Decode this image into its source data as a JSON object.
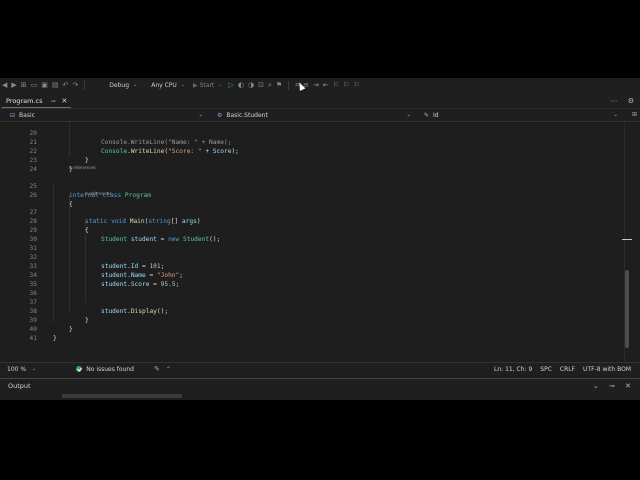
{
  "toolbar": {
    "config": "Debug",
    "platform": "Any CPU",
    "start_label": "Start"
  },
  "tab": {
    "label": "Program.cs"
  },
  "navbar": {
    "project": "Basic",
    "type": "Basic.Student",
    "member": "Id"
  },
  "editor": {
    "codelens_text": "0 references",
    "lines": [
      "20",
      "21",
      "22",
      "23",
      "24",
      "25",
      "26",
      "27",
      "28",
      "29",
      "30",
      "31",
      "32",
      "33",
      "34",
      "35",
      "36",
      "37",
      "38",
      "39",
      "40",
      "41"
    ]
  },
  "status": {
    "zoom": "100 %",
    "issues": "No issues found",
    "position": "Ln: 11, Ch: 9",
    "indent": "SPC",
    "line_ending": "CRLF",
    "encoding": "UTF-8 with BOM"
  },
  "output": {
    "title": "Output"
  },
  "colors": {
    "keyword": "#569cd6",
    "type": "#4ec9b0",
    "method": "#dcdcaa",
    "string": "#d69d85",
    "number": "#b5cea8",
    "ok": "#3ba55c"
  }
}
